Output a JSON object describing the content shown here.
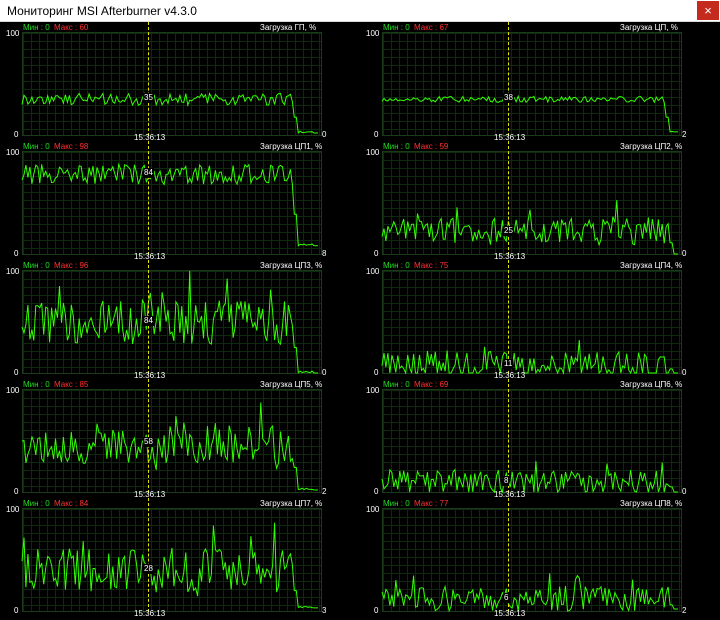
{
  "window": {
    "title": "Мониторинг MSI Afterburner v4.3.0",
    "close_glyph": "×"
  },
  "cursor_time": "15:36:13",
  "colors": {
    "line": "#33ff00",
    "min": "#22dd22",
    "max": "#ff3030",
    "cursor": "#e6e600"
  },
  "graphs": [
    {
      "id": "gpu",
      "title": "Загрузка ГП, %",
      "min_label": "Мин : 0",
      "max_label": "Макс : 60",
      "ymax": "100",
      "ymin": "0",
      "cursor_value": "35",
      "current_value": "0",
      "level": 0.35,
      "noise": 0.06,
      "drop_at": 0.92,
      "end_level": 0.02
    },
    {
      "id": "cpu",
      "title": "Загрузка ЦП, %",
      "min_label": "Мин : 0",
      "max_label": "Макс : 67",
      "ymax": "100",
      "ymin": "0",
      "cursor_value": "38",
      "current_value": "2",
      "level": 0.35,
      "noise": 0.03,
      "drop_at": 0.96,
      "end_level": 0.03
    },
    {
      "id": "cpu1",
      "title": "Загрузка ЦП1, %",
      "min_label": "Мин : 0",
      "max_label": "Макс : 98",
      "ymax": "100",
      "ymin": "0",
      "cursor_value": "84",
      "current_value": "8",
      "level": 0.78,
      "noise": 0.1,
      "drop_at": 0.92,
      "end_level": 0.08
    },
    {
      "id": "cpu2",
      "title": "Загрузка ЦП2, %",
      "min_label": "Мин : 0",
      "max_label": "Макс : 59",
      "ymax": "100",
      "ymin": "0",
      "cursor_value": "25",
      "current_value": "0",
      "level": 0.22,
      "noise": 0.13,
      "drop_at": 0.97,
      "end_level": 0.0
    },
    {
      "id": "cpu3",
      "title": "Загрузка ЦП3, %",
      "min_label": "Мин : 0",
      "max_label": "Макс : 96",
      "ymax": "100",
      "ymin": "0",
      "cursor_value": "84",
      "current_value": "0",
      "level": 0.5,
      "noise": 0.22,
      "drop_at": 0.92,
      "end_level": 0.0
    },
    {
      "id": "cpu4",
      "title": "Загрузка ЦП4, %",
      "min_label": "Мин : 0",
      "max_label": "Макс : 75",
      "ymax": "100",
      "ymin": "0",
      "cursor_value": "11",
      "current_value": "0",
      "level": 0.08,
      "noise": 0.14,
      "drop_at": 0.97,
      "end_level": 0.0
    },
    {
      "id": "cpu5",
      "title": "Загрузка ЦП5, %",
      "min_label": "Мин : 0",
      "max_label": "Макс : 85",
      "ymax": "100",
      "ymin": "0",
      "cursor_value": "58",
      "current_value": "2",
      "level": 0.48,
      "noise": 0.2,
      "drop_at": 0.92,
      "end_level": 0.02
    },
    {
      "id": "cpu6",
      "title": "Загрузка ЦП6, %",
      "min_label": "Мин : 0",
      "max_label": "Макс : 69",
      "ymax": "100",
      "ymin": "0",
      "cursor_value": "8",
      "current_value": "0",
      "level": 0.1,
      "noise": 0.12,
      "drop_at": 0.97,
      "end_level": 0.0
    },
    {
      "id": "cpu7",
      "title": "Загрузка ЦП7, %",
      "min_label": "Мин : 0",
      "max_label": "Макс : 84",
      "ymax": "100",
      "ymin": "0",
      "cursor_value": "28",
      "current_value": "3",
      "level": 0.4,
      "noise": 0.22,
      "drop_at": 0.92,
      "end_level": 0.03
    },
    {
      "id": "cpu8",
      "title": "Загрузка ЦП8, %",
      "min_label": "Мин : 0",
      "max_label": "Макс : 77",
      "ymax": "100",
      "ymin": "0",
      "cursor_value": "6",
      "current_value": "2",
      "level": 0.12,
      "noise": 0.12,
      "drop_at": 0.97,
      "end_level": 0.02
    }
  ]
}
